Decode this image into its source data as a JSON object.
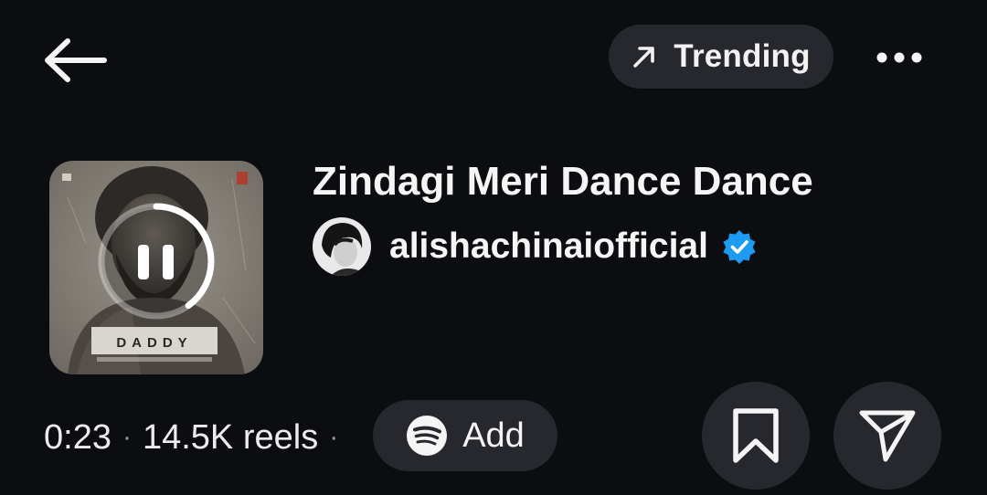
{
  "header": {
    "back_icon": "arrow-left-icon",
    "trending_icon": "arrow-up-right-icon",
    "trending_label": "Trending",
    "more_icon": "more-horizontal-icon"
  },
  "track": {
    "title": "Zindagi Meri Dance Dance",
    "artist": "alishachinaiofficial",
    "verified": true,
    "album_art_text": "DADDY",
    "playback_state": "playing",
    "progress_fraction": 0.4
  },
  "stats": {
    "duration": "0:23",
    "separator": "·",
    "reels_count": "14.5K reels"
  },
  "actions": {
    "add_label": "Add",
    "add_icon": "spotify-icon",
    "save_icon": "bookmark-icon",
    "share_icon": "send-icon"
  },
  "colors": {
    "background": "#0c0d10",
    "pill": "#26282d",
    "verified_blue": "#1d9bf0"
  }
}
